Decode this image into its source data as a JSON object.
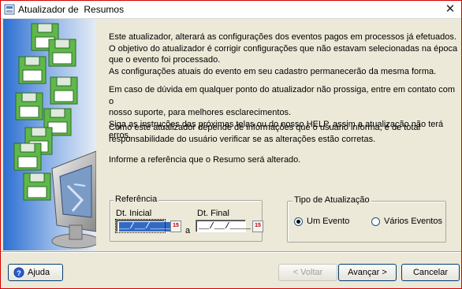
{
  "window": {
    "title": "Atualizador de  Resumos",
    "close_glyph": "✕"
  },
  "intro": {
    "p1": [
      "Este atualizador, alterará as configurações dos eventos pagos em processos já efetuados.",
      " O objetivo do atualizador é corrigir configurações que não estavam selecionadas na época",
      "que o evento foi processado.",
      " As configurações atuais do evento em seu cadastro permanecerão da mesma forma."
    ],
    "p2": [
      " Em caso de dúvida em qualquer ponto do atualizador não prossiga, entre em contato com o",
      "nosso suporte, para melhores esclarecimentos.",
      " Siga as instruções das próximas telas ou do nosso HELP, assim a atualização não terá erros."
    ],
    "p3": [
      " Como este atualizador depende de informações que o usuário informa, é de total",
      "responsabilidade do usuário verificar se as alterações estão corretas."
    ],
    "p4": [
      "Informe a referência que o Resumo será alterado."
    ]
  },
  "referencia": {
    "label": "Referência",
    "dt_inicial_label": "Dt. Inicial",
    "dt_inicial_value": "__/__/____",
    "separator": "a",
    "dt_final_label": "Dt. Final",
    "dt_final_value": "__/__/____",
    "calendar_glyph": "15"
  },
  "tipo": {
    "label": "Tipo de Atualização",
    "options": [
      {
        "label": "Um Evento",
        "selected": true
      },
      {
        "label": "Vários Eventos",
        "selected": false
      }
    ]
  },
  "buttons": {
    "ajuda": "Ajuda",
    "voltar": "< Voltar",
    "avancar": "Avançar >",
    "cancelar": "Cancelar"
  },
  "colors": {
    "accent_border": "#d40000",
    "selection": "#316ac5",
    "floppy_green": "#5fb84a"
  }
}
